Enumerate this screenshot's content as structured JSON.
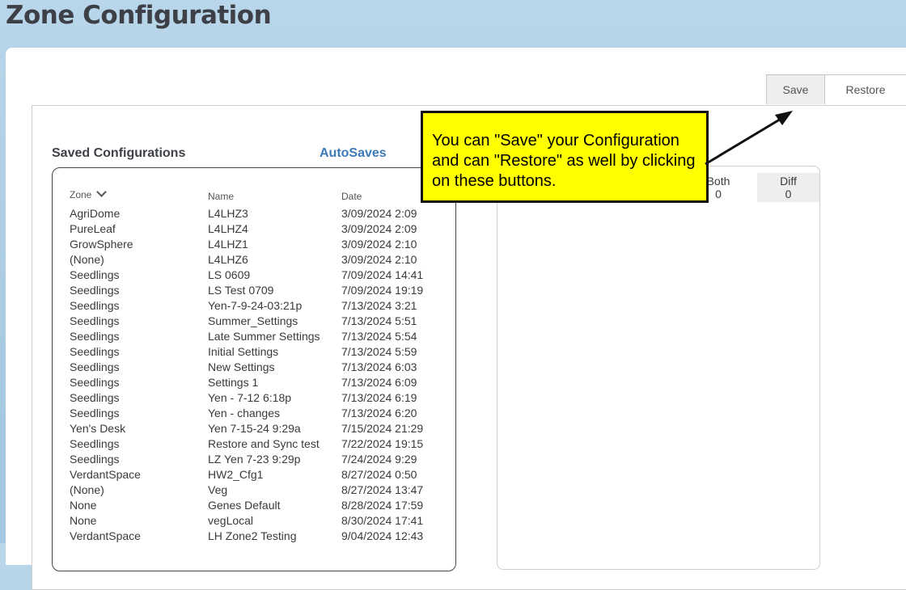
{
  "page": {
    "title": "Zone Configuration"
  },
  "tabs": [
    {
      "label": "Save"
    },
    {
      "label": "Restore"
    }
  ],
  "saved": {
    "title": "Saved Configurations",
    "autosaves_link": "AutoSaves",
    "columns": {
      "zone": "Zone",
      "name": "Name",
      "date": "Date"
    },
    "rows": [
      {
        "zone": "AgriDome",
        "name": "L4LHZ3",
        "date": "3/09/2024 2:09"
      },
      {
        "zone": "PureLeaf",
        "name": "L4LHZ4",
        "date": "3/09/2024 2:09"
      },
      {
        "zone": "GrowSphere",
        "name": "L4LHZ1",
        "date": "3/09/2024 2:10"
      },
      {
        "zone": "(None)",
        "name": "L4LHZ6",
        "date": "3/09/2024 2:10"
      },
      {
        "zone": "Seedlings",
        "name": "LS 0609",
        "date": "7/09/2024 14:41"
      },
      {
        "zone": "Seedlings",
        "name": "LS Test 0709",
        "date": "7/09/2024 19:19"
      },
      {
        "zone": "Seedlings",
        "name": "Yen-7-9-24-03:21p",
        "date": "7/13/2024 3:21"
      },
      {
        "zone": "Seedlings",
        "name": "Summer_Settings",
        "date": "7/13/2024 5:51"
      },
      {
        "zone": "Seedlings",
        "name": "Late Summer Settings",
        "date": "7/13/2024 5:54"
      },
      {
        "zone": "Seedlings",
        "name": "Initial Settings",
        "date": "7/13/2024 5:59"
      },
      {
        "zone": "Seedlings",
        "name": "New Settings",
        "date": "7/13/2024 6:03"
      },
      {
        "zone": "Seedlings",
        "name": "Settings 1",
        "date": "7/13/2024 6:09"
      },
      {
        "zone": "Seedlings",
        "name": "Yen - 7-12 6:18p",
        "date": "7/13/2024 6:19"
      },
      {
        "zone": "Seedlings",
        "name": "Yen - changes",
        "date": "7/13/2024 6:20"
      },
      {
        "zone": "Yen's Desk",
        "name": "Yen 7-15-24 9:29a",
        "date": "7/15/2024 21:29"
      },
      {
        "zone": "Seedlings",
        "name": "Restore and Sync test",
        "date": "7/22/2024 19:15"
      },
      {
        "zone": "Seedlings",
        "name": "LZ Yen 7-23 9:29p",
        "date": "7/24/2024 9:29"
      },
      {
        "zone": "VerdantSpace",
        "name": "HW2_Cfg1",
        "date": "8/27/2024 0:50"
      },
      {
        "zone": "(None)",
        "name": "Veg",
        "date": "8/27/2024 13:47"
      },
      {
        "zone": "None",
        "name": "Genes Default",
        "date": "8/28/2024 17:59"
      },
      {
        "zone": "None",
        "name": "vegLocal",
        "date": "8/30/2024 17:41"
      },
      {
        "zone": "VerdantSpace",
        "name": "LH Zone2 Testing",
        "date": "9/04/2024 12:43"
      }
    ]
  },
  "compare": {
    "both_label": "Both",
    "both_value": "0",
    "diff_label": "Diff",
    "diff_value": "0"
  },
  "callout": {
    "text": "You can \"Save\" your Configuration and can \"Restore\" as well by clicking on these buttons."
  },
  "icons": {
    "sort": "chevron-down-icon",
    "pointer": "arrow-icon"
  },
  "colors": {
    "accent": "#3d7ab7",
    "callout_bg": "#ffff00",
    "header_bg": "#b9d6ea"
  }
}
